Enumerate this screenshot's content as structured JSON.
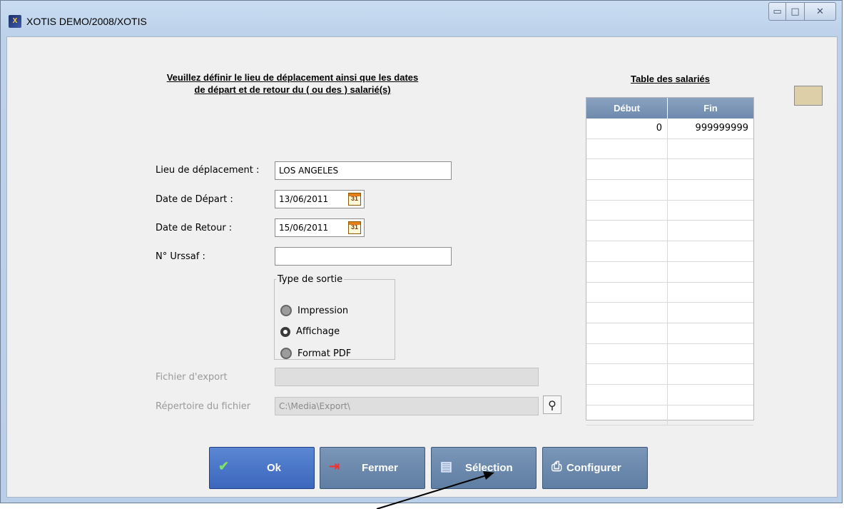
{
  "window": {
    "title": "XOTIS DEMO/2008/XOTIS",
    "app_icon_text": "X",
    "minimize_glyph": "▭",
    "maximize_glyph": "□",
    "close_glyph": "✕"
  },
  "form": {
    "heading_line1": "Veuillez définir le lieu de déplacement ainsi que les dates",
    "heading_line2": "de départ et de retour du ( ou des ) salarié(s)",
    "lieu_label": "Lieu de déplacement :",
    "lieu_value": "LOS ANGELES",
    "depart_label": "Date de Départ :",
    "depart_value": "13/06/2011",
    "retour_label": "Date de Retour :",
    "retour_value": "15/06/2011",
    "calendar_glyph": "31",
    "urssaf_label": "N° Urssaf :",
    "urssaf_value": "",
    "sortie_legend": "Type de sortie",
    "sortie_options": [
      "Impression",
      "Affichage",
      "Format PDF"
    ],
    "sortie_selected": "Affichage",
    "export_label": "Fichier d'export",
    "export_value": "",
    "repertoire_label": "Répertoire du fichier",
    "repertoire_value": "C:\\Media\\Export\\",
    "search_glyph": "⚲"
  },
  "table": {
    "title": "Table des salariés",
    "columns": [
      "Début",
      "Fin"
    ],
    "rows": [
      [
        "0",
        "999999999"
      ],
      [
        "",
        ""
      ],
      [
        "",
        ""
      ],
      [
        "",
        ""
      ],
      [
        "",
        ""
      ],
      [
        "",
        ""
      ],
      [
        "",
        ""
      ],
      [
        "",
        ""
      ],
      [
        "",
        ""
      ],
      [
        "",
        ""
      ],
      [
        "",
        ""
      ],
      [
        "",
        ""
      ],
      [
        "",
        ""
      ],
      [
        "",
        ""
      ],
      [
        "",
        ""
      ]
    ]
  },
  "buttons": {
    "ok": {
      "label": "Ok",
      "icon": "✔"
    },
    "fermer": {
      "label": "Fermer",
      "icon": "⇥"
    },
    "selection": {
      "label": "Sélection",
      "icon": "▤"
    },
    "configurer": {
      "label": "Configurer",
      "icon": "⎙"
    }
  },
  "colors": {
    "client_bg": "#f0f0f0",
    "button_bg": "#6a88ad",
    "ok_button_bg": "#4874c8",
    "grid_header": "#7d96b6",
    "swatch": "#ddd0a8"
  }
}
